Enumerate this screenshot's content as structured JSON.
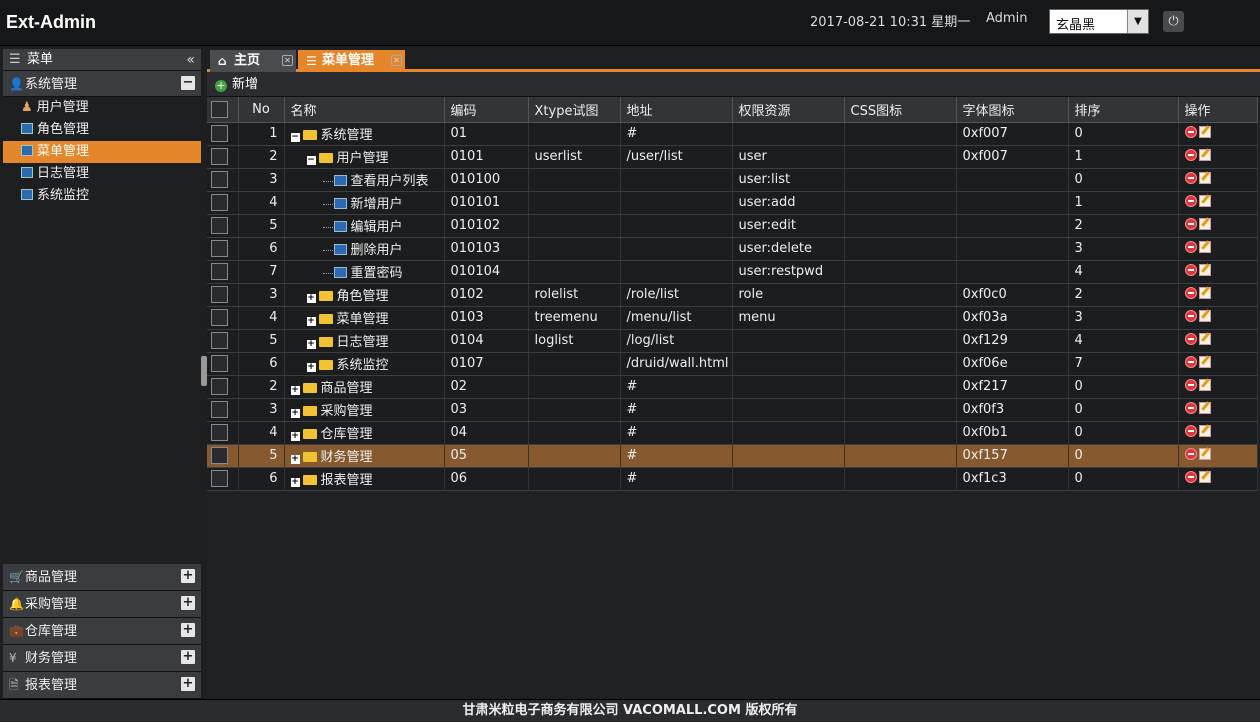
{
  "app": {
    "title": "Ext-Admin",
    "datetime": "2017-08-21 10:31 星期一",
    "user": "Admin",
    "theme": "玄晶黑"
  },
  "sidebar": {
    "header": "菜单",
    "group": "系统管理",
    "items": [
      {
        "label": "用户管理",
        "icon": "user-icon"
      },
      {
        "label": "角色管理",
        "icon": "grid-icon"
      },
      {
        "label": "菜单管理",
        "icon": "grid-icon",
        "selected": true
      },
      {
        "label": "日志管理",
        "icon": "grid-icon"
      },
      {
        "label": "系统监控",
        "icon": "grid-icon"
      }
    ],
    "bottom_groups": [
      "商品管理",
      "采购管理",
      "仓库管理",
      "财务管理",
      "报表管理"
    ]
  },
  "tabs": [
    {
      "label": "主页"
    },
    {
      "label": "菜单管理"
    }
  ],
  "toolbar": {
    "add_label": "新增"
  },
  "grid": {
    "columns": [
      "No",
      "名称",
      "编码",
      "Xtype试图",
      "地址",
      "权限资源",
      "CSS图标",
      "字体图标",
      "排序",
      "操作"
    ],
    "rows": [
      {
        "no": "1",
        "name": "系统管理",
        "code": "01",
        "xtype": "",
        "url": "#",
        "perm": "",
        "css": "",
        "font": "0xf007",
        "sort": "0",
        "level": 0,
        "type": "folder-open"
      },
      {
        "no": "2",
        "name": "用户管理",
        "code": "0101",
        "xtype": "userlist",
        "url": "/user/list",
        "perm": "user",
        "css": "",
        "font": "0xf007",
        "sort": "1",
        "level": 1,
        "type": "folder-open"
      },
      {
        "no": "3",
        "name": "查看用户列表",
        "code": "010100",
        "xtype": "",
        "url": "",
        "perm": "user:list",
        "css": "",
        "font": "",
        "sort": "0",
        "level": 2,
        "type": "leaf"
      },
      {
        "no": "4",
        "name": "新增用户",
        "code": "010101",
        "xtype": "",
        "url": "",
        "perm": "user:add",
        "css": "",
        "font": "",
        "sort": "1",
        "level": 2,
        "type": "leaf"
      },
      {
        "no": "5",
        "name": "编辑用户",
        "code": "010102",
        "xtype": "",
        "url": "",
        "perm": "user:edit",
        "css": "",
        "font": "",
        "sort": "2",
        "level": 2,
        "type": "leaf"
      },
      {
        "no": "6",
        "name": "删除用户",
        "code": "010103",
        "xtype": "",
        "url": "",
        "perm": "user:delete",
        "css": "",
        "font": "",
        "sort": "3",
        "level": 2,
        "type": "leaf"
      },
      {
        "no": "7",
        "name": "重置密码",
        "code": "010104",
        "xtype": "",
        "url": "",
        "perm": "user:restpwd",
        "css": "",
        "font": "",
        "sort": "4",
        "level": 2,
        "type": "leaf"
      },
      {
        "no": "3",
        "name": "角色管理",
        "code": "0102",
        "xtype": "rolelist",
        "url": "/role/list",
        "perm": "role",
        "css": "",
        "font": "0xf0c0",
        "sort": "2",
        "level": 1,
        "type": "folder"
      },
      {
        "no": "4",
        "name": "菜单管理",
        "code": "0103",
        "xtype": "treemenu",
        "url": "/menu/list",
        "perm": "menu",
        "css": "",
        "font": "0xf03a",
        "sort": "3",
        "level": 1,
        "type": "folder"
      },
      {
        "no": "5",
        "name": "日志管理",
        "code": "0104",
        "xtype": "loglist",
        "url": "/log/list",
        "perm": "",
        "css": "",
        "font": "0xf129",
        "sort": "4",
        "level": 1,
        "type": "folder"
      },
      {
        "no": "6",
        "name": "系统监控",
        "code": "0107",
        "xtype": "",
        "url": "/druid/wall.html",
        "perm": "",
        "css": "",
        "font": "0xf06e",
        "sort": "7",
        "level": 1,
        "type": "folder"
      },
      {
        "no": "2",
        "name": "商品管理",
        "code": "02",
        "xtype": "",
        "url": "#",
        "perm": "",
        "css": "",
        "font": "0xf217",
        "sort": "0",
        "level": 0,
        "type": "folder"
      },
      {
        "no": "3",
        "name": "采购管理",
        "code": "03",
        "xtype": "",
        "url": "#",
        "perm": "",
        "css": "",
        "font": "0xf0f3",
        "sort": "0",
        "level": 0,
        "type": "folder"
      },
      {
        "no": "4",
        "name": "仓库管理",
        "code": "04",
        "xtype": "",
        "url": "#",
        "perm": "",
        "css": "",
        "font": "0xf0b1",
        "sort": "0",
        "level": 0,
        "type": "folder"
      },
      {
        "no": "5",
        "name": "财务管理",
        "code": "05",
        "xtype": "",
        "url": "#",
        "perm": "",
        "css": "",
        "font": "0xf157",
        "sort": "0",
        "level": 0,
        "type": "folder",
        "highlight": true
      },
      {
        "no": "6",
        "name": "报表管理",
        "code": "06",
        "xtype": "",
        "url": "#",
        "perm": "",
        "css": "",
        "font": "0xf1c3",
        "sort": "0",
        "level": 0,
        "type": "folder"
      }
    ]
  },
  "footer": {
    "text": "甘肃米粒电子商务有限公司 VACOMALL.COM 版权所有"
  },
  "colors": {
    "accent": "#e5862a",
    "highlight_row": "#865a2e",
    "background": "#1e1f21"
  }
}
